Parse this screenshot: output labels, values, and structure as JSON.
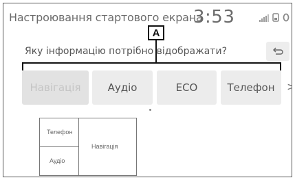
{
  "header": {
    "title": "Настроювання стартового екрана",
    "time": "3:53"
  },
  "status_icons": [
    "signal-icon",
    "phone-icon",
    "bluetooth-icon"
  ],
  "prompt": {
    "question": "Яку інформацію потрібно відображати?",
    "back_icon": "back-arrow-icon"
  },
  "callout": {
    "label": "A"
  },
  "tabs": [
    {
      "label": "Навігація",
      "state": "disabled"
    },
    {
      "label": "Аудіо",
      "state": "normal"
    },
    {
      "label": "ECO",
      "state": "normal"
    },
    {
      "label": "Телефон",
      "state": "normal"
    }
  ],
  "next_arrow": ">",
  "preview": {
    "top_left": "Телефон",
    "bottom_left": "Аудіо",
    "right": "Навігація"
  },
  "colors": {
    "tab_bg": "#ececec",
    "tab_disabled_bg": "#e2e2e2",
    "text": "#555555"
  }
}
